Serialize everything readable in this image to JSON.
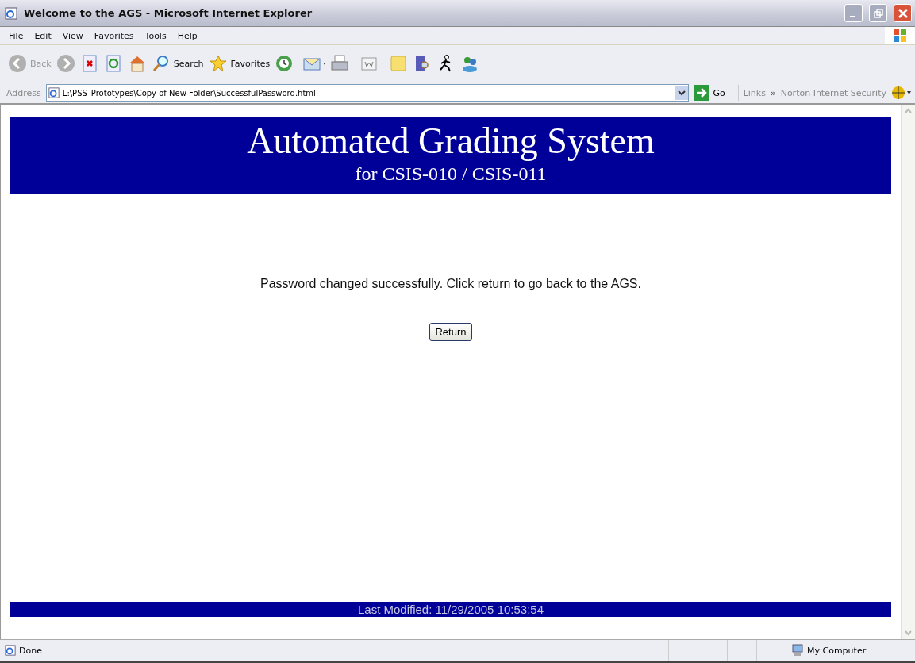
{
  "window": {
    "title": "Welcome to the AGS - Microsoft Internet Explorer"
  },
  "menu": [
    "File",
    "Edit",
    "View",
    "Favorites",
    "Tools",
    "Help"
  ],
  "toolbar": [
    {
      "kind": "back",
      "label": "Back",
      "disabled": true
    },
    {
      "kind": "forward",
      "disabled": true
    },
    {
      "kind": "stop"
    },
    {
      "kind": "refresh"
    },
    {
      "kind": "home"
    },
    {
      "kind": "search",
      "label": "Search"
    },
    {
      "kind": "favorites",
      "label": "Favorites"
    },
    {
      "kind": "history"
    },
    {
      "kind": "mail"
    },
    {
      "kind": "print"
    },
    {
      "kind": "word"
    },
    {
      "kind": "note"
    },
    {
      "kind": "research"
    },
    {
      "kind": "runner"
    },
    {
      "kind": "messenger"
    }
  ],
  "address": {
    "label": "Address",
    "value": "L:\\PSS_Prototypes\\Copy of New Folder\\SuccessfulPassword.html",
    "go": "Go",
    "links": "Links",
    "chevron": "»",
    "norton": "Norton Internet Security"
  },
  "page": {
    "title": "Automated Grading System",
    "subtitle": "for CSIS-010 / CSIS-011",
    "message": "Password changed successfully. Click return to go back to the AGS.",
    "button": "Return",
    "footer": "Last Modified: 11/29/2005 10:53:54"
  },
  "status_bar": {
    "text": "Done",
    "zone": "My Computer"
  }
}
